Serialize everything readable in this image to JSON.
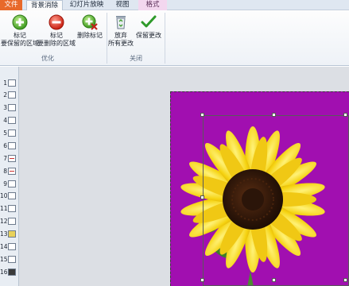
{
  "tabs": {
    "file": "文件",
    "background_removal": "背景消除",
    "slideshow": "幻灯片放映",
    "view": "视图",
    "format": "格式"
  },
  "ribbon": {
    "mark_keep_line1": "标记",
    "mark_keep_line2": "要保留的区域",
    "mark_remove_line1": "标记",
    "mark_remove_line2": "要删除的区域",
    "delete_mark": "删除标记",
    "group_optimize": "优化",
    "discard_line1": "放弃",
    "discard_line2": "所有更改",
    "keep_changes": "保留更改",
    "group_close": "关闭"
  },
  "slides": [
    "1",
    "2",
    "3",
    "4",
    "5",
    "6",
    "7",
    "8",
    "9",
    "10",
    "11",
    "12",
    "13",
    "14",
    "15",
    "16"
  ],
  "colors": {
    "file_tab": "#e8692a",
    "slide_background": "#a10fb0",
    "format_tab": "#f3d7ef"
  }
}
